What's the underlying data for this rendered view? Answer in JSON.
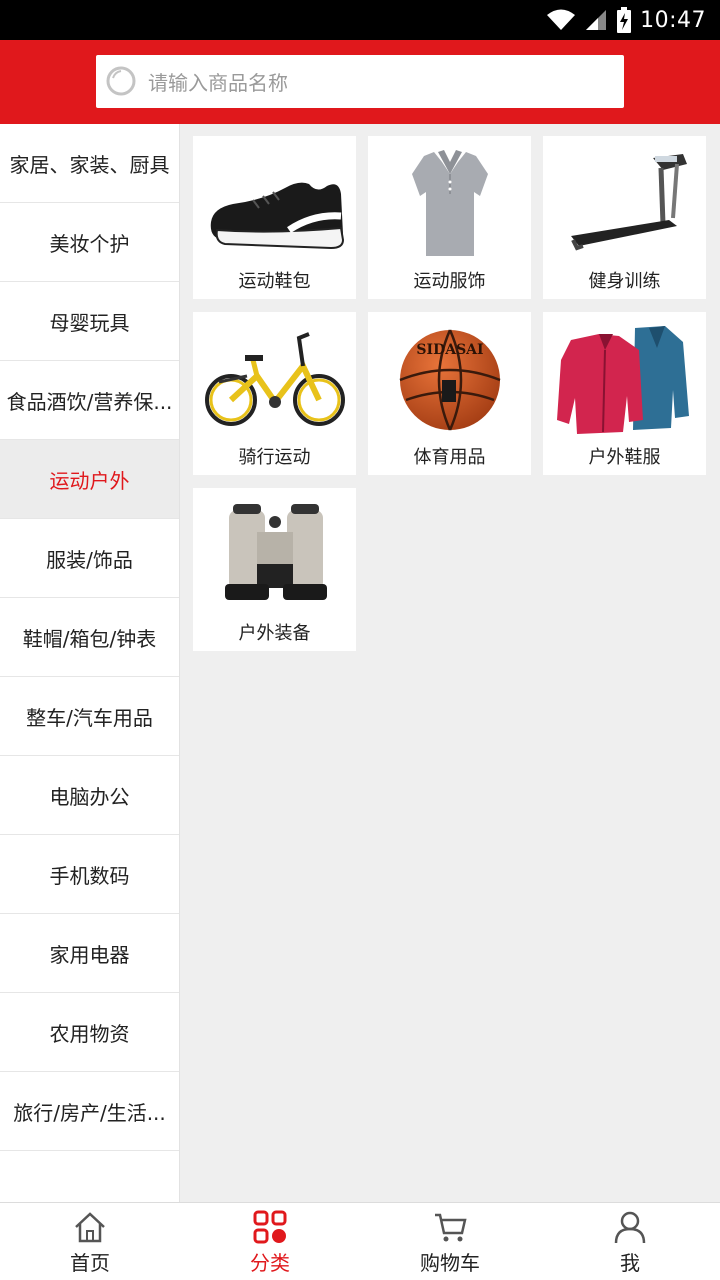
{
  "status": {
    "time": "10:47"
  },
  "search": {
    "placeholder": "请输入商品名称"
  },
  "sidebar": {
    "items": [
      {
        "label": "家居、家装、厨具"
      },
      {
        "label": "美妆个护"
      },
      {
        "label": "母婴玩具"
      },
      {
        "label": "食品酒饮/营养保..."
      },
      {
        "label": "运动户外"
      },
      {
        "label": "服装/饰品"
      },
      {
        "label": "鞋帽/箱包/钟表"
      },
      {
        "label": "整车/汽车用品"
      },
      {
        "label": "电脑办公"
      },
      {
        "label": "手机数码"
      },
      {
        "label": "家用电器"
      },
      {
        "label": "农用物资"
      },
      {
        "label": "旅行/房产/生活..."
      }
    ],
    "active_label": "运动户外"
  },
  "products": [
    {
      "label": "运动鞋包",
      "icon": "sneaker-icon"
    },
    {
      "label": "运动服饰",
      "icon": "polo-shirt-icon"
    },
    {
      "label": "健身训练",
      "icon": "treadmill-icon"
    },
    {
      "label": "骑行运动",
      "icon": "bicycle-icon"
    },
    {
      "label": "体育用品",
      "icon": "basketball-icon"
    },
    {
      "label": "户外鞋服",
      "icon": "jackets-icon"
    },
    {
      "label": "户外装备",
      "icon": "binoculars-icon"
    }
  ],
  "basketball_text": "SIDASAI",
  "bottomnav": {
    "items": [
      {
        "label": "首页",
        "icon": "home-icon"
      },
      {
        "label": "分类",
        "icon": "category-icon"
      },
      {
        "label": "购物车",
        "icon": "cart-icon"
      },
      {
        "label": "我",
        "icon": "user-icon"
      }
    ]
  },
  "colors": {
    "accent": "#e0181c",
    "background": "#efefef"
  }
}
